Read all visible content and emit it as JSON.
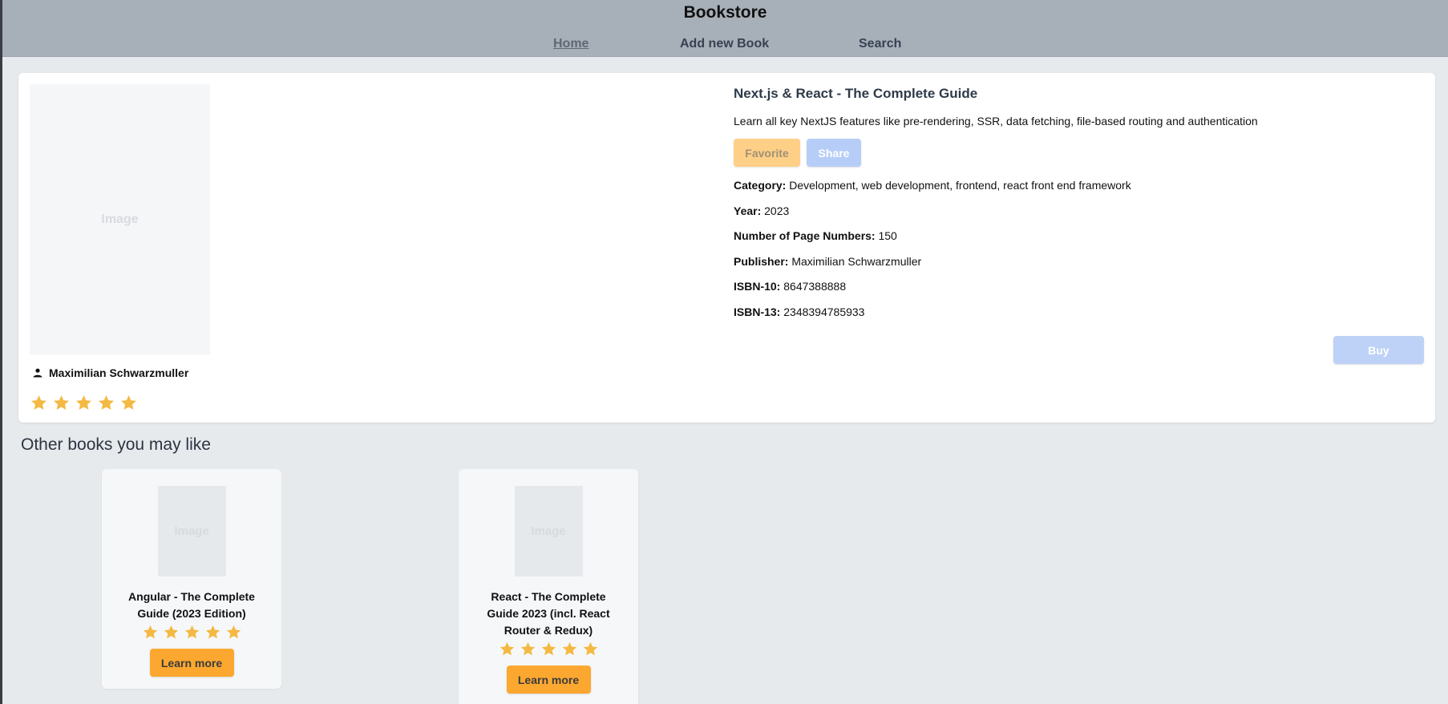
{
  "header": {
    "brand": "Bookstore",
    "nav": [
      {
        "label": "Home",
        "active": true
      },
      {
        "label": "Add new Book",
        "active": false
      },
      {
        "label": "Search",
        "active": false
      }
    ]
  },
  "book": {
    "image_placeholder": "Image",
    "author": "Maximilian Schwarzmuller",
    "rating": 5,
    "title": "Next.js & React - The Complete Guide",
    "description": "Learn all key NextJS features like pre-rendering, SSR, data fetching, file-based routing and authentication",
    "favorite_label": "Favorite",
    "share_label": "Share",
    "buy_label": "Buy",
    "fields": [
      {
        "label": "Category:",
        "value": "Development, web development, frontend, react front end framework"
      },
      {
        "label": "Year:",
        "value": "2023"
      },
      {
        "label": "Number of Page Numbers:",
        "value": "150"
      },
      {
        "label": "Publisher:",
        "value": "Maximilian Schwarzmuller"
      },
      {
        "label": "ISBN-10:",
        "value": "8647388888"
      },
      {
        "label": "ISBN-13:",
        "value": "2348394785933"
      }
    ]
  },
  "recommendations": {
    "heading": "Other books you may like",
    "items": [
      {
        "image_placeholder": "Image",
        "title": "Angular - The Complete Guide (2023 Edition)",
        "rating": 5,
        "button_label": "Learn more"
      },
      {
        "image_placeholder": "Image",
        "title": "React - The Complete Guide 2023 (incl. React Router & Redux)",
        "rating": 5,
        "button_label": "Learn more"
      }
    ]
  },
  "colors": {
    "header_bg": "#a7afb9",
    "page_bg": "#e6eaed",
    "star": "#f4b942",
    "accent_orange": "#fca730",
    "favorite_disabled": "#fecf86",
    "blue_disabled": "#b6cef7"
  }
}
